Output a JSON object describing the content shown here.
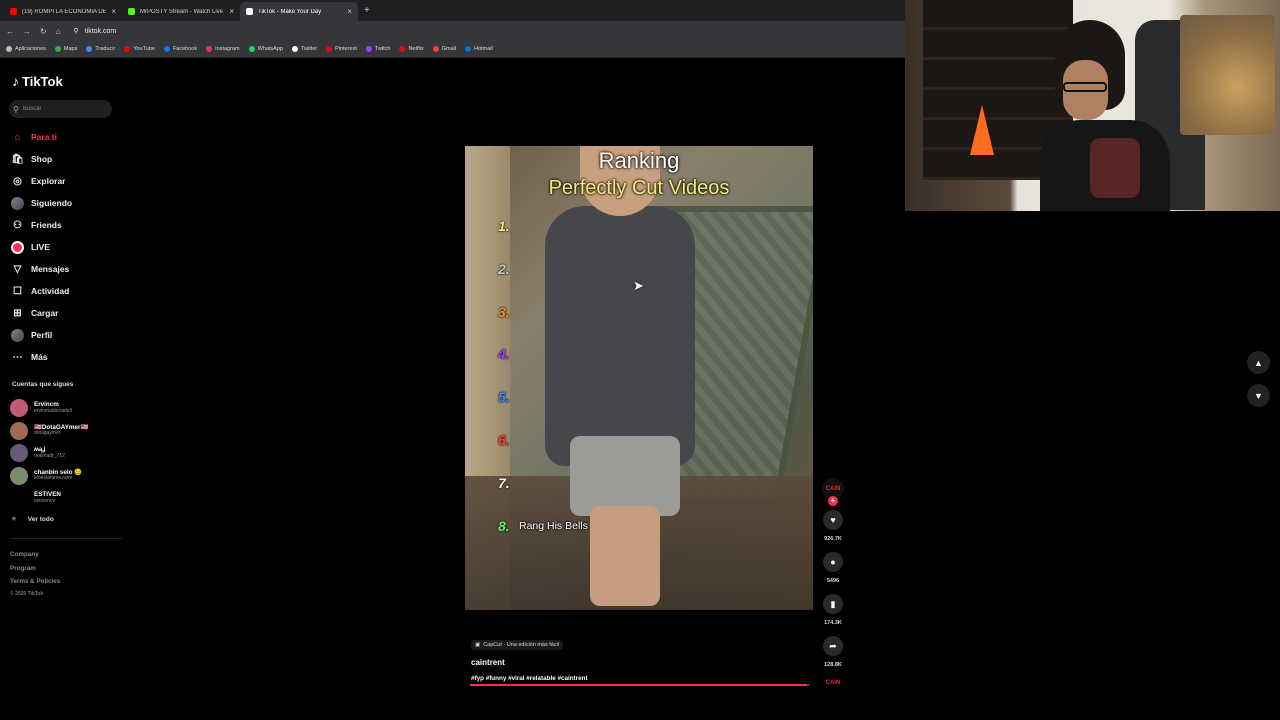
{
  "browser": {
    "tabs": [
      {
        "title": "(19) ROMPÍ LA ECONOMIA DE",
        "favicon_color": "#ff0000",
        "active": false
      },
      {
        "title": "MrPOSTY Stream - Watch Live",
        "favicon_color": "#53fc18",
        "active": false
      },
      {
        "title": "TikTok - Make Your Day",
        "favicon_color": "#ffffff",
        "active": true
      }
    ],
    "new_tab": "+",
    "url": "tiktok.com",
    "bookmarks": [
      {
        "label": "Aplicaciones",
        "color": "#c0c0c0"
      },
      {
        "label": "Maps",
        "color": "#34a853"
      },
      {
        "label": "Traducir",
        "color": "#4285f4"
      },
      {
        "label": "YouTube",
        "color": "#ff0000"
      },
      {
        "label": "Facebook",
        "color": "#1877f2"
      },
      {
        "label": "Instagram",
        "color": "#e1306c"
      },
      {
        "label": "WhatsApp",
        "color": "#25d366"
      },
      {
        "label": "Twitter",
        "color": "#ffffff"
      },
      {
        "label": "Pinterest",
        "color": "#e60023"
      },
      {
        "label": "Twitch",
        "color": "#9146ff"
      },
      {
        "label": "Netflix",
        "color": "#e50914"
      },
      {
        "label": "Gmail",
        "color": "#ea4335"
      },
      {
        "label": "Hotmail",
        "color": "#0078d4"
      }
    ]
  },
  "tiktok": {
    "logo": "TikTok",
    "search_placeholder": "Buscar",
    "nav": [
      {
        "label": "Para ti",
        "icon": "home-icon",
        "glyph": "⌂",
        "active": true
      },
      {
        "label": "Shop",
        "icon": "shop-icon",
        "glyph": "🛍",
        "active": false
      },
      {
        "label": "Explorar",
        "icon": "compass-icon",
        "glyph": "◎",
        "active": false
      },
      {
        "label": "Siguiendo",
        "icon": "following-avatar-icon",
        "glyph": "",
        "active": false
      },
      {
        "label": "Friends",
        "icon": "friends-icon",
        "glyph": "⚇",
        "active": false
      },
      {
        "label": "LIVE",
        "icon": "live-icon",
        "glyph": "",
        "active": false
      },
      {
        "label": "Mensajes",
        "icon": "messages-icon",
        "glyph": "▽",
        "active": false
      },
      {
        "label": "Actividad",
        "icon": "activity-icon",
        "glyph": "☐",
        "active": false
      },
      {
        "label": "Cargar",
        "icon": "upload-icon",
        "glyph": "⊞",
        "active": false
      },
      {
        "label": "Perfil",
        "icon": "profile-avatar-icon",
        "glyph": "",
        "active": false
      },
      {
        "label": "Más",
        "icon": "more-icon",
        "glyph": "⋯",
        "active": false
      }
    ],
    "following_title": "Cuentas que sigues",
    "following": [
      {
        "name": "Ervincm",
        "handle": "ervinmaldonadoll",
        "color": "#c25a78"
      },
      {
        "name": "🇺🇸DotaGAYmer🇺🇸",
        "handle": "dotagaymer",
        "color": "#a06a55"
      },
      {
        "name": "ʍąʝ",
        "handle": "realmadr_712",
        "color": "#6a5a7a"
      },
      {
        "name": "chanbin selo 😊",
        "handle": "leoestefania.rami",
        "color": "#7a8a6a"
      },
      {
        "name": "ESTIVEN",
        "handle": "estivencv",
        "color": "#000000"
      }
    ],
    "see_all": "Ver todo",
    "footer": [
      "Company",
      "Program",
      "Terms & Policies"
    ],
    "copyright": "© 2026 TikTok"
  },
  "video": {
    "title": "Ranking",
    "subtitle": "Perfectly Cut Videos",
    "ranks": [
      {
        "n": "1.",
        "color": "#f4e97b"
      },
      {
        "n": "2.",
        "color": "#c8c8c8"
      },
      {
        "n": "3.",
        "color": "#f08c3c"
      },
      {
        "n": "4.",
        "color": "#a040ff"
      },
      {
        "n": "5.",
        "color": "#3c8cff"
      },
      {
        "n": "6.",
        "color": "#ff3c3c"
      },
      {
        "n": "7.",
        "color": "#ffffff"
      },
      {
        "n": "8.",
        "color": "#6cf06c"
      }
    ],
    "rank8_label": "Rang His Bells",
    "capcut": "CapCut · Una edición más fácil",
    "author": "caintrent",
    "hashtags": "#fyp #funny #viral #relatable #caintrent",
    "progress": 0.99
  },
  "actions": {
    "creator_tag": "CAIN",
    "likes": "926.7K",
    "comments": "5496",
    "saves": "174.3K",
    "shares": "128.8K",
    "music_tag": "CAIN"
  }
}
